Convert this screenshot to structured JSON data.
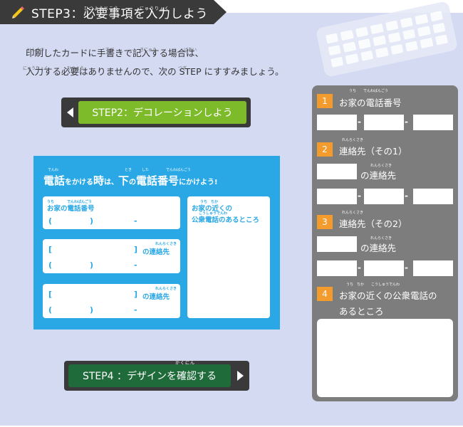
{
  "header": {
    "title": "STEP3：必要事項を入力しよう",
    "ruby_hitsuyoujikou": "ひつようじこう",
    "ruby_nyuuryoku": "にゅうりょく"
  },
  "intro": {
    "line1": "印刷したカードに手書きで記入する場合は、",
    "line2": "入力する必要はありませんので、次の STEP にすすみましょう。",
    "ruby_insatsu": "いんさつ",
    "ruby_tegaki": "てが",
    "ruby_kinyuu": "きにゅう",
    "ruby_baai": "ばあい",
    "ruby_nyuuryoku": "にゅうりょく",
    "ruby_hitsuyou": "ひつよう",
    "ruby_tsugi": "つぎ"
  },
  "nav": {
    "prev_label": "STEP2：デコレーションしよう",
    "next_label": "STEP4 ：デザインを確認する",
    "next_ruby": "かくにん"
  },
  "card": {
    "title_a": "電話",
    "title_b": "をかける",
    "title_c": "時",
    "title_d": "は、",
    "title_e": "下",
    "title_f": "の",
    "title_g": "電話番号",
    "title_h": "にかけよう!",
    "ruby_denwa": "でんわ",
    "ruby_toki": "とき",
    "ruby_shita": "した",
    "ruby_denwabangou": "でんわばんごう",
    "home_label": "お家の電話番号",
    "home_ruby_uchi": "うち",
    "home_ruby_denwa": "でんわばんごう",
    "paren_open": "(",
    "paren_close": ")",
    "dash": "-",
    "bracket_open": "[",
    "bracket_close": "]",
    "contact_label": "の連絡先",
    "contact_ruby": "れんらくさき",
    "near_label_1": "お家の近くの",
    "near_label_2": "公衆電話のあるところ",
    "near_ruby_1": "うち　ちか",
    "near_ruby_2": "こうしゅうでんわ"
  },
  "form": {
    "n1": "1",
    "n2": "2",
    "n3": "3",
    "n4": "4",
    "label1": "お家の電話番号",
    "ruby1": "うち　　でんわばんごう",
    "label2": "連絡先（その1）",
    "ruby2": "れんらくさき",
    "label3": "連絡先（その2）",
    "ruby3": "れんらくさき",
    "contact_suffix": "の連絡先",
    "contact_suffix_ruby": "れんらくさき",
    "label4_line1": "お家の近くの公衆電話の",
    "label4_line2": "あるところ",
    "ruby4": "うち　ちか　　こうしゅうでんわ",
    "dash": "-"
  },
  "colors": {
    "dark": "#3a3a3a",
    "green": "#7dbb2a",
    "dark_green": "#1f6b3a",
    "blue": "#2aa8e6",
    "orange": "#f39c2d",
    "gray_panel": "#7d7d7d",
    "bg": "#d3daf2"
  },
  "icons": {
    "header": "pencil-icon",
    "prev": "arrow-left-icon",
    "next": "arrow-right-icon",
    "decor": "keyboard-icon"
  }
}
